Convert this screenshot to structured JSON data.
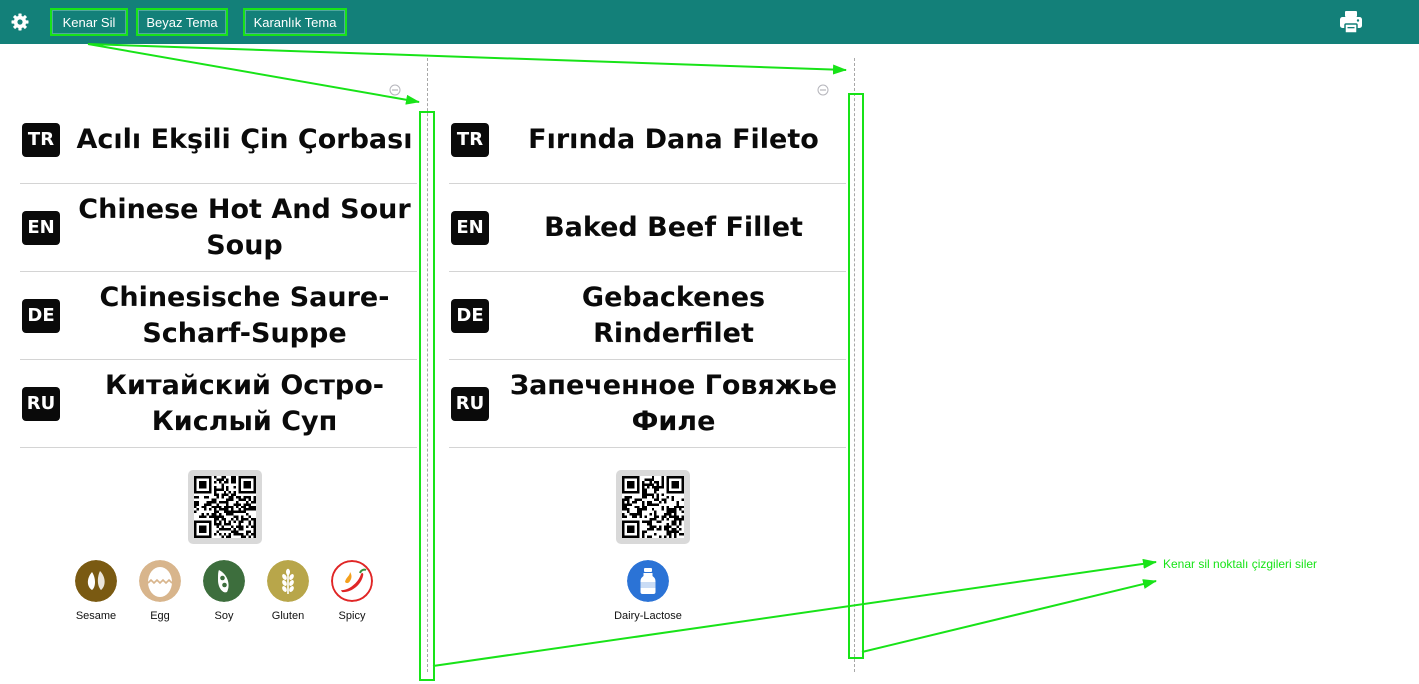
{
  "toolbar": {
    "buttons": [
      "Kenar Sil",
      "Beyaz Tema",
      "Karanlık Tema"
    ],
    "settings_icon": "gear-icon",
    "print_icon": "print-icon",
    "background": "#138079"
  },
  "cards": [
    {
      "rows": [
        {
          "lang": "TR",
          "name": "Acılı Ekşili Çin Çorbası"
        },
        {
          "lang": "EN",
          "name": "Chinese Hot And Sour Soup"
        },
        {
          "lang": "DE",
          "name": "Chinesische Saure-Scharf-Suppe"
        },
        {
          "lang": "RU",
          "name": "Китайский Остро-Кислый Суп"
        }
      ],
      "allergens": [
        {
          "label": "Sesame",
          "icon": "sesame-icon",
          "color": "#7a5a12"
        },
        {
          "label": "Egg",
          "icon": "egg-icon",
          "color": "#d8b58c"
        },
        {
          "label": "Soy",
          "icon": "soy-icon",
          "color": "#3d6e3d"
        },
        {
          "label": "Gluten",
          "icon": "gluten-icon",
          "color": "#b8a64a"
        },
        {
          "label": "Spicy",
          "icon": "chili-icon",
          "color": "#e02626"
        }
      ]
    },
    {
      "rows": [
        {
          "lang": "TR",
          "name": "Fırında Dana Fileto"
        },
        {
          "lang": "EN",
          "name": "Baked Beef Fillet"
        },
        {
          "lang": "DE",
          "name": "Gebackenes Rinderfilet"
        },
        {
          "lang": "RU",
          "name": "Запеченное Говяжье Филе"
        }
      ],
      "allergens": [
        {
          "label": "Dairy-Lactose",
          "icon": "milk-bottle-icon",
          "color": "#2b73d6"
        }
      ]
    }
  ],
  "annotation": {
    "text": "Kenar sil noktalı çizgileri siler",
    "color": "#18e318"
  }
}
